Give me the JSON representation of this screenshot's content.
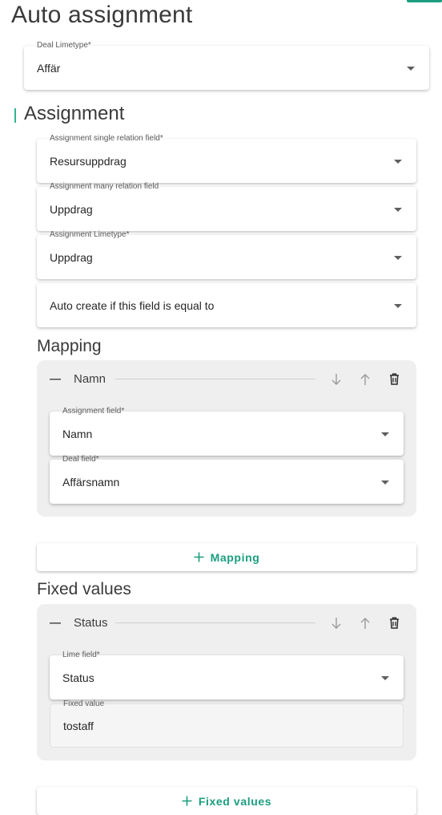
{
  "page": {
    "title": "Auto assignment"
  },
  "deal_limetype": {
    "label": "Deal Limetype*",
    "value": "Affär"
  },
  "assignment": {
    "title": "Assignment",
    "single_relation": {
      "label": "Assignment single relation field*",
      "value": "Resursuppdrag"
    },
    "many_relation": {
      "label": "Assignment many relation field",
      "value": "Uppdrag"
    },
    "limetype": {
      "label": "Assignment Limetype*",
      "value": "Uppdrag"
    },
    "auto_create": {
      "placeholder": "Auto create if this field is equal to"
    }
  },
  "mapping": {
    "title": "Mapping",
    "item": {
      "title": "Namn",
      "assignment_field": {
        "label": "Assignment field*",
        "value": "Namn"
      },
      "deal_field": {
        "label": "Deal field*",
        "value": "Affärsnamn"
      }
    },
    "add_label": "Mapping"
  },
  "fixed_values": {
    "title": "Fixed values",
    "item": {
      "title": "Status",
      "lime_field": {
        "label": "Lime field*",
        "value": "Status"
      },
      "fixed_value": {
        "label": "Fixed value",
        "value": "tostaff"
      }
    },
    "add_label": "Fixed values"
  },
  "icons": {
    "collapse": "minus-icon",
    "move_down": "arrow-down-icon",
    "move_up": "arrow-up-icon",
    "delete": "trash-icon",
    "add": "plus-icon",
    "dropdown": "caret-down-icon"
  },
  "colors": {
    "accent": "#1b9e80",
    "section_bar": "#2fb592",
    "group_background": "#efefef"
  }
}
